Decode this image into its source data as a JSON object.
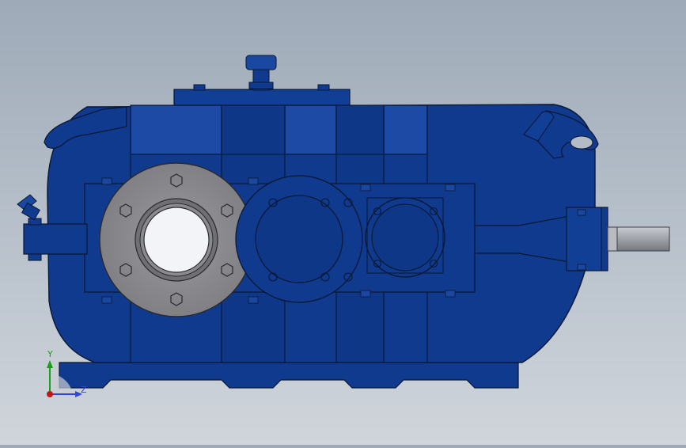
{
  "viewport": {
    "model": "gearbox-3d-model",
    "view": "front"
  },
  "colors": {
    "housing": "#0f3a8e",
    "housing_dark": "#0c2f75",
    "housing_light": "#1f4ba6",
    "outline": "#0a1733",
    "flange": "#8a8a8e",
    "bore": "#f2f4f8",
    "shaft": "#a3a6ab",
    "axis_y": "#18a018",
    "axis_z": "#2f47d8",
    "axis_origin": "#c41616"
  },
  "triad": {
    "y_label": "Y",
    "z_label": "Z"
  }
}
